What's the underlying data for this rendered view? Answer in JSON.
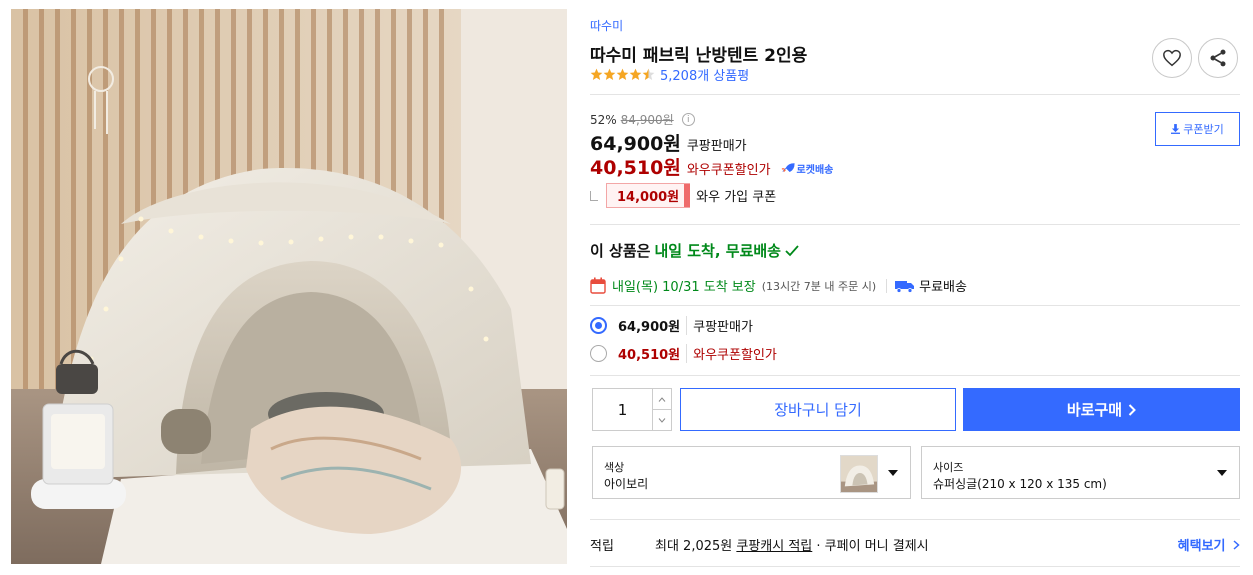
{
  "product": {
    "brand": "따수미",
    "title": "따수미 패브릭 난방텐트 2인용",
    "rating_stars": 4.5,
    "review_count": "5,208개 상품평"
  },
  "pricing": {
    "discount_rate": "52%",
    "original_price": "84,900원",
    "sale_price": "64,900원",
    "sale_label": "쿠팡판매가",
    "wow_price": "40,510원",
    "wow_label": "와우쿠폰할인가",
    "rocket_label": "로켓배송",
    "coupon_button": "쿠폰받기",
    "wow_coupon_amount": "14,000원",
    "wow_coupon_label": "와우 가입 쿠폰"
  },
  "delivery": {
    "headline_prefix": "이 상품은",
    "headline_green": "내일 도착, 무료배송",
    "arrival_date": "내일(목) 10/31 도착 보장",
    "order_deadline": "(13시간 7분 내 주문 시)",
    "free_shipping": "무료배송"
  },
  "options": [
    {
      "price": "64,900원",
      "label": "쿠팡판매가",
      "selected": true
    },
    {
      "price": "40,510원",
      "label": "와우쿠폰할인가",
      "selected": false
    }
  ],
  "purchase": {
    "quantity": "1",
    "cart_label": "장바구니 담기",
    "buy_label": "바로구매"
  },
  "selectors": {
    "color_label": "색상",
    "color_value": "아이보리",
    "size_label": "사이즈",
    "size_value": "슈퍼싱글(210 x 120 x 135 cm)"
  },
  "points": {
    "title": "적립",
    "text_prefix": "최대 2,025원",
    "text_link": "쿠팡캐시 적립",
    "text_suffix": "· 쿠페이 머니 결제시",
    "benefit_link": "혜택보기"
  },
  "colors": {
    "accent_blue": "#346aff",
    "sale_red": "#ae0000",
    "delivery_green": "#00891a",
    "star_orange": "#f5a623"
  }
}
